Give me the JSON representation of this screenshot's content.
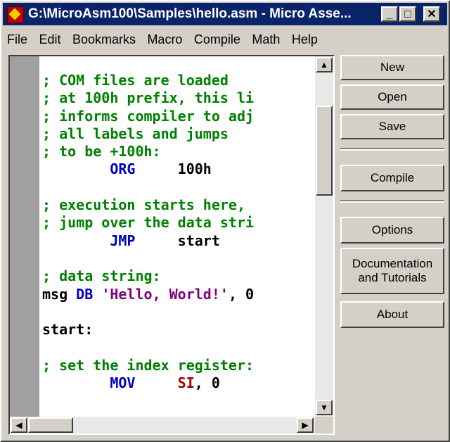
{
  "window": {
    "title": "G:\\MicroAsm100\\Samples\\hello.asm - Micro Asse...",
    "minimize_glyph": "_",
    "maximize_glyph": "□",
    "close_glyph": "✕"
  },
  "menu": [
    "File",
    "Edit",
    "Bookmarks",
    "Macro",
    "Compile",
    "Math",
    "Help"
  ],
  "code_lines": [
    [
      {
        "t": "; COM files are loaded",
        "c": "comment"
      }
    ],
    [
      {
        "t": "; at 100h prefix, this li",
        "c": "comment"
      }
    ],
    [
      {
        "t": "; informs compiler to adj",
        "c": "comment"
      }
    ],
    [
      {
        "t": "; all labels and jumps",
        "c": "comment"
      }
    ],
    [
      {
        "t": "; to be +100h:",
        "c": "comment"
      }
    ],
    [
      {
        "t": "        ",
        "c": "plain"
      },
      {
        "t": "ORG",
        "c": "kw"
      },
      {
        "t": "     100h",
        "c": "plain"
      }
    ],
    [],
    [
      {
        "t": "; execution starts here,",
        "c": "comment"
      }
    ],
    [
      {
        "t": "; jump over the data stri",
        "c": "comment"
      }
    ],
    [
      {
        "t": "        ",
        "c": "plain"
      },
      {
        "t": "JMP",
        "c": "kw"
      },
      {
        "t": "     start",
        "c": "plain"
      }
    ],
    [],
    [
      {
        "t": "; data string:",
        "c": "comment"
      }
    ],
    [
      {
        "t": "msg ",
        "c": "plain"
      },
      {
        "t": "DB",
        "c": "kw"
      },
      {
        "t": " ",
        "c": "plain"
      },
      {
        "t": "'Hello, World!'",
        "c": "str"
      },
      {
        "t": ", 0",
        "c": "plain"
      }
    ],
    [],
    [
      {
        "t": "start:",
        "c": "plain"
      }
    ],
    [],
    [
      {
        "t": "; set the index register:",
        "c": "comment"
      }
    ],
    [
      {
        "t": "        ",
        "c": "plain"
      },
      {
        "t": "MOV",
        "c": "kw"
      },
      {
        "t": "     ",
        "c": "plain"
      },
      {
        "t": "SI",
        "c": "reg"
      },
      {
        "t": ", 0",
        "c": "plain"
      }
    ]
  ],
  "scroll_glyphs": {
    "up": "▲",
    "down": "▼",
    "left": "◀",
    "right": "▶"
  },
  "buttons": {
    "new": "New",
    "open": "Open",
    "save": "Save",
    "compile": "Compile",
    "options": "Options",
    "docs_line1": "Documentation",
    "docs_line2": "and Tutorials",
    "about": "About"
  },
  "colors": {
    "comment": "#008000",
    "keyword": "#0000c0",
    "string": "#800080",
    "register": "#a00000",
    "titlebar": "#0a246a"
  }
}
